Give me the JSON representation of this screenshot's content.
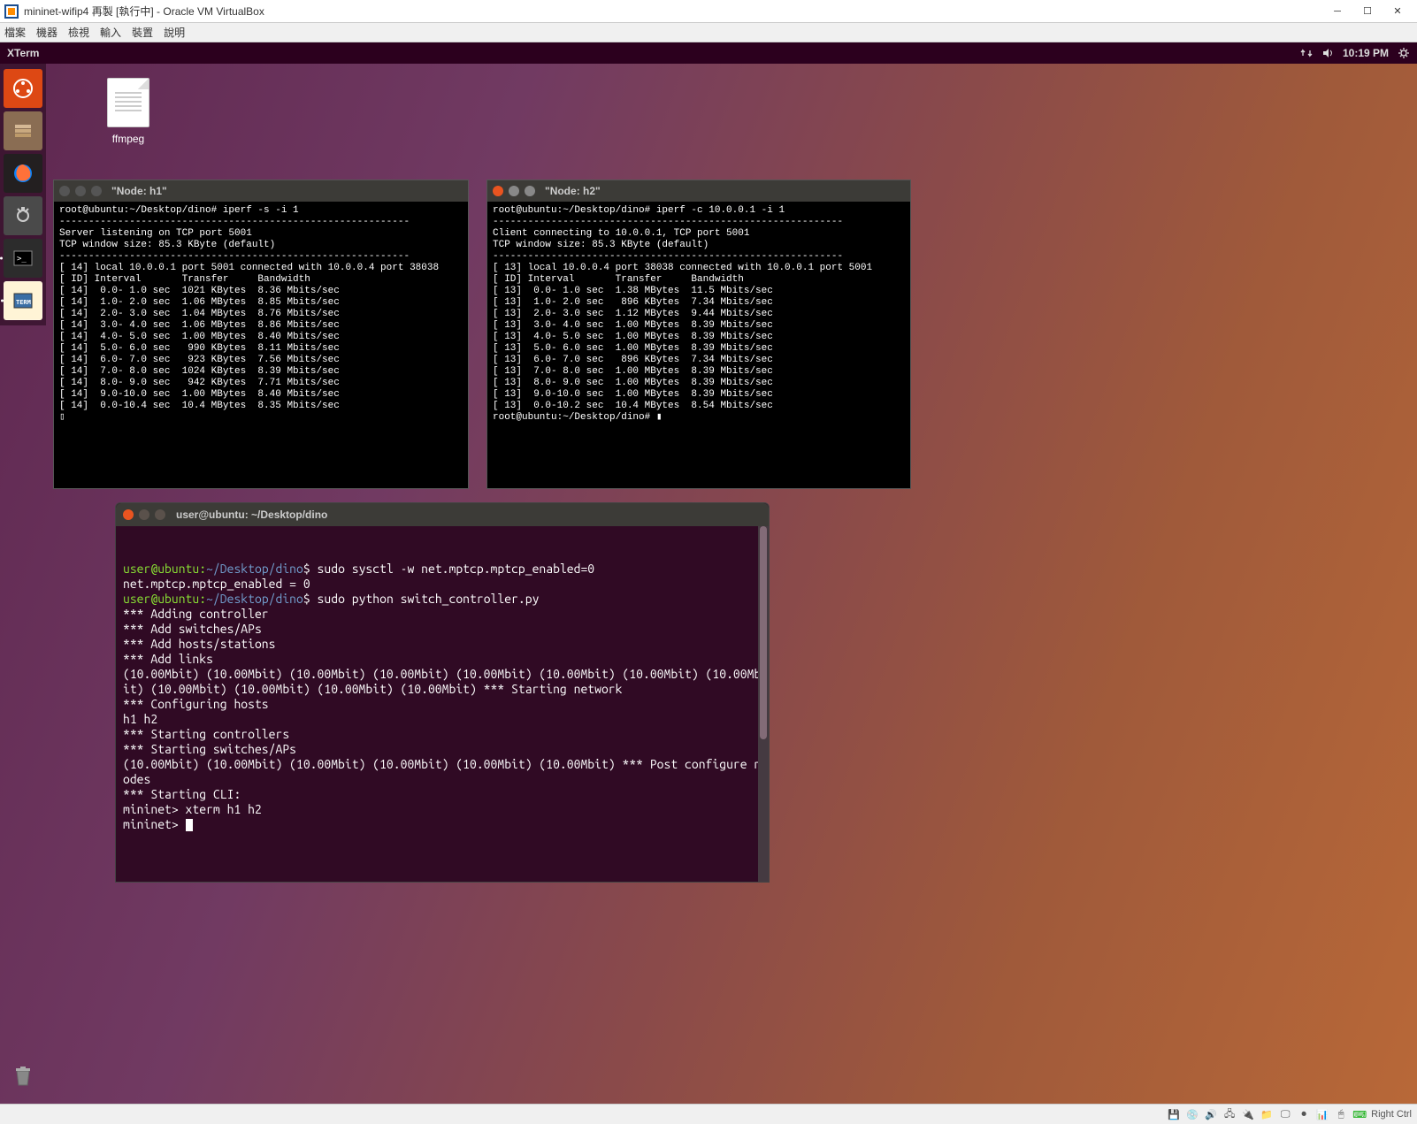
{
  "vb": {
    "title": "mininet-wifip4 再製 [執行中] - Oracle VM VirtualBox",
    "menu": [
      "檔案",
      "機器",
      "檢視",
      "輸入",
      "裝置",
      "說明"
    ]
  },
  "panel": {
    "app": "XTerm",
    "time": "10:19 PM"
  },
  "desktop": {
    "icon1": "ffmpeg"
  },
  "xterm1": {
    "title": "\"Node: h1\"",
    "cmd": "root@ubuntu:~/Desktop/dino# iperf -s -i 1",
    "header": "------------------------------------------------------------\nServer listening on TCP port 5001\nTCP window size: 85.3 KByte (default)\n------------------------------------------------------------",
    "conn": "[ 14] local 10.0.0.1 port 5001 connected with 10.0.0.4 port 38038",
    "cols": "[ ID] Interval       Transfer     Bandwidth",
    "rows": [
      "[ 14]  0.0- 1.0 sec  1021 KBytes  8.36 Mbits/sec",
      "[ 14]  1.0- 2.0 sec  1.06 MBytes  8.85 Mbits/sec",
      "[ 14]  2.0- 3.0 sec  1.04 MBytes  8.76 Mbits/sec",
      "[ 14]  3.0- 4.0 sec  1.06 MBytes  8.86 Mbits/sec",
      "[ 14]  4.0- 5.0 sec  1.00 MBytes  8.40 Mbits/sec",
      "[ 14]  5.0- 6.0 sec   990 KBytes  8.11 Mbits/sec",
      "[ 14]  6.0- 7.0 sec   923 KBytes  7.56 Mbits/sec",
      "[ 14]  7.0- 8.0 sec  1024 KBytes  8.39 Mbits/sec",
      "[ 14]  8.0- 9.0 sec   942 KBytes  7.71 Mbits/sec",
      "[ 14]  9.0-10.0 sec  1.00 MBytes  8.40 Mbits/sec",
      "[ 14]  0.0-10.4 sec  10.4 MBytes  8.35 Mbits/sec"
    ]
  },
  "xterm2": {
    "title": "\"Node: h2\"",
    "cmd": "root@ubuntu:~/Desktop/dino# iperf -c 10.0.0.1 -i 1",
    "header": "------------------------------------------------------------\nClient connecting to 10.0.0.1, TCP port 5001\nTCP window size: 85.3 KByte (default)\n------------------------------------------------------------",
    "conn": "[ 13] local 10.0.0.4 port 38038 connected with 10.0.0.1 port 5001",
    "cols": "[ ID] Interval       Transfer     Bandwidth",
    "rows": [
      "[ 13]  0.0- 1.0 sec  1.38 MBytes  11.5 Mbits/sec",
      "[ 13]  1.0- 2.0 sec   896 KBytes  7.34 Mbits/sec",
      "[ 13]  2.0- 3.0 sec  1.12 MBytes  9.44 Mbits/sec",
      "[ 13]  3.0- 4.0 sec  1.00 MBytes  8.39 Mbits/sec",
      "[ 13]  4.0- 5.0 sec  1.00 MBytes  8.39 Mbits/sec",
      "[ 13]  5.0- 6.0 sec  1.00 MBytes  8.39 Mbits/sec",
      "[ 13]  6.0- 7.0 sec   896 KBytes  7.34 Mbits/sec",
      "[ 13]  7.0- 8.0 sec  1.00 MBytes  8.39 Mbits/sec",
      "[ 13]  8.0- 9.0 sec  1.00 MBytes  8.39 Mbits/sec",
      "[ 13]  9.0-10.0 sec  1.00 MBytes  8.39 Mbits/sec",
      "[ 13]  0.0-10.2 sec  10.4 MBytes  8.54 Mbits/sec"
    ],
    "prompt2": "root@ubuntu:~/Desktop/dino# "
  },
  "gterm": {
    "title": "user@ubuntu: ~/Desktop/dino",
    "prompt_user": "user@ubuntu:",
    "prompt_path": "~/Desktop/dino",
    "cmd1": "sudo sysctl -w net.mptcp.mptcp_enabled=0",
    "out1": "net.mptcp.mptcp_enabled = 0",
    "cmd2": "sudo python switch_controller.py",
    "body": "*** Adding controller\n*** Add switches/APs\n*** Add hosts/stations\n*** Add links\n(10.00Mbit) (10.00Mbit) (10.00Mbit) (10.00Mbit) (10.00Mbit) (10.00Mbit) (10.00Mbit) (10.00Mbit) (10.00Mbit) (10.00Mbit) (10.00Mbit) (10.00Mbit) *** Starting network\n*** Configuring hosts\nh1 h2\n*** Starting controllers\n*** Starting switches/APs\n(10.00Mbit) (10.00Mbit) (10.00Mbit) (10.00Mbit) (10.00Mbit) (10.00Mbit) *** Post configure nodes\n*** Starting CLI:\nmininet> xterm h1 h2\nmininet> ",
    "scroll_pos": "top"
  },
  "status": {
    "hostkey": "Right Ctrl"
  }
}
